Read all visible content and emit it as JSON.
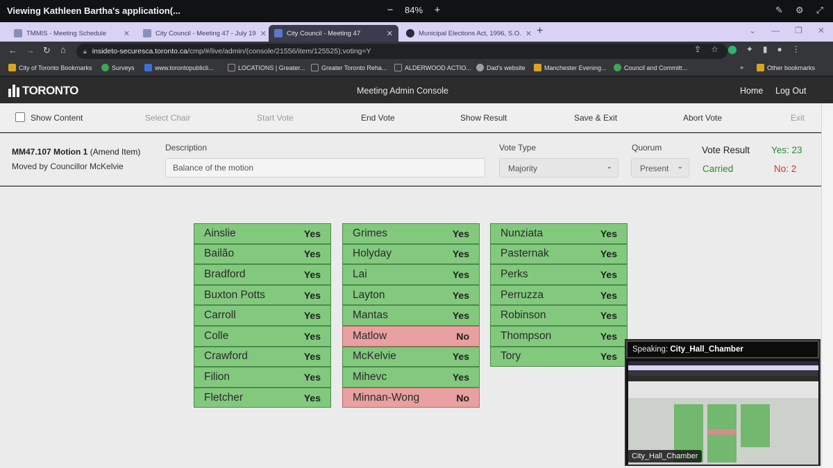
{
  "share_bar": {
    "title": "Viewing Kathleen Bartha's application(...",
    "zoom": "84%",
    "zoom_out": "−",
    "zoom_in": "+"
  },
  "browser": {
    "tabs": [
      {
        "label": "TMMIS - Meeting Schedule",
        "active": false
      },
      {
        "label": "City Council - Meeting 47 - July 19",
        "active": false
      },
      {
        "label": "City Council - Meeting 47",
        "active": true
      },
      {
        "label": "Municipal Elections Act, 1996, S.O.",
        "active": false
      }
    ],
    "new_tab": "+",
    "url_host": "insideto-securesca.toronto.ca",
    "url_path": "/cmp/#/live/admin/(console/21556/item/125525);voting=Y",
    "bookmarks": [
      {
        "label": "City of Toronto Bookmarks",
        "icon": "folder-icon"
      },
      {
        "label": "Surveys",
        "icon": "globe-icon"
      },
      {
        "label": "www.torontopublicli...",
        "icon": "tpl-icon"
      },
      {
        "label": "LOCATIONS | Greater...",
        "icon": "page-icon"
      },
      {
        "label": "Greater Toronto Reha...",
        "icon": "page-icon"
      },
      {
        "label": "ALDERWOOD ACTIO...",
        "icon": "page-icon"
      },
      {
        "label": "Dad's website",
        "icon": "globe-icon"
      },
      {
        "label": "Manchester Evening...",
        "icon": "folder-icon"
      },
      {
        "label": "Council and Committ...",
        "icon": "globe-icon"
      },
      {
        "label": "Other bookmarks",
        "icon": "folder-icon"
      }
    ],
    "bookmarks_more": "»"
  },
  "app_header": {
    "logo_text": "TORONTO",
    "title": "Meeting Admin Console",
    "home": "Home",
    "logout": "Log Out"
  },
  "actions": {
    "show_content": "Show Content",
    "select_chair": "Select Chair",
    "start_vote": "Start Vote",
    "end_vote": "End Vote",
    "show_result": "Show Result",
    "save_exit": "Save & Exit",
    "abort_vote": "Abort Vote",
    "exit": "Exit"
  },
  "motion": {
    "id": "MM47.107 Motion 1",
    "item_type": "(Amend Item)",
    "moved_by": "Moved by Councillor McKelvie",
    "description_label": "Description",
    "description_value": "Balance of the motion",
    "vote_type_label": "Vote Type",
    "vote_type_value": "Majority",
    "quorum_label": "Quorum",
    "quorum_value": "Present",
    "result_label": "Vote Result",
    "result_status": "Carried",
    "yes_count": "Yes: 23",
    "no_count": "No: 2",
    "status_colors": {
      "yes": "#2d8a2d",
      "no": "#d23030"
    }
  },
  "votes": {
    "columns": [
      [
        {
          "name": "Ainslie",
          "vote": "Yes"
        },
        {
          "name": "Bailão",
          "vote": "Yes"
        },
        {
          "name": "Bradford",
          "vote": "Yes"
        },
        {
          "name": "Buxton Potts",
          "vote": "Yes"
        },
        {
          "name": "Carroll",
          "vote": "Yes"
        },
        {
          "name": "Colle",
          "vote": "Yes"
        },
        {
          "name": "Crawford",
          "vote": "Yes"
        },
        {
          "name": "Filion",
          "vote": "Yes"
        },
        {
          "name": "Fletcher",
          "vote": "Yes"
        }
      ],
      [
        {
          "name": "Grimes",
          "vote": "Yes"
        },
        {
          "name": "Holyday",
          "vote": "Yes"
        },
        {
          "name": "Lai",
          "vote": "Yes"
        },
        {
          "name": "Layton",
          "vote": "Yes"
        },
        {
          "name": "Mantas",
          "vote": "Yes"
        },
        {
          "name": "Matlow",
          "vote": "No"
        },
        {
          "name": "McKelvie",
          "vote": "Yes"
        },
        {
          "name": "Mihevc",
          "vote": "Yes"
        },
        {
          "name": "Minnan-Wong",
          "vote": "No"
        }
      ],
      [
        {
          "name": "Nunziata",
          "vote": "Yes"
        },
        {
          "name": "Pasternak",
          "vote": "Yes"
        },
        {
          "name": "Perks",
          "vote": "Yes"
        },
        {
          "name": "Perruzza",
          "vote": "Yes"
        },
        {
          "name": "Robinson",
          "vote": "Yes"
        },
        {
          "name": "Thompson",
          "vote": "Yes"
        },
        {
          "name": "Tory",
          "vote": "Yes"
        }
      ]
    ],
    "colors": {
      "yes": "#82c97e",
      "no": "#e9a0a0"
    }
  },
  "pip": {
    "speaking_label": "Speaking:",
    "speaker": "City_Hall_Chamber",
    "caption": "City_Hall_Chamber"
  }
}
